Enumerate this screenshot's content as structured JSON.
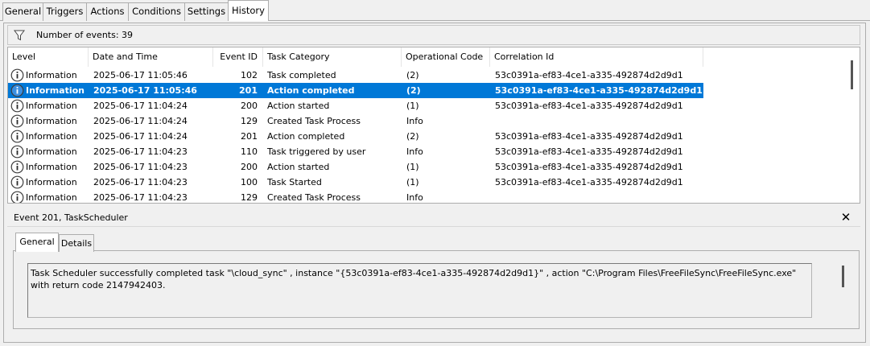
{
  "tabs": [
    "General",
    "Triggers",
    "Actions",
    "Conditions",
    "Settings",
    "History"
  ],
  "active_tab": "History",
  "filter": {
    "label": "Number of events: 39"
  },
  "columns": [
    "Level",
    "Date and Time",
    "Event ID",
    "Task Category",
    "Operational Code",
    "Correlation Id"
  ],
  "events": [
    {
      "level": "Information",
      "datetime": "2025-06-17 11:05:46",
      "event_id": "102",
      "category": "Task completed",
      "opcode": "(2)",
      "correlation": "53c0391a-ef83-4ce1-a335-492874d2d9d1"
    },
    {
      "level": "Information",
      "datetime": "2025-06-17 11:05:46",
      "event_id": "201",
      "category": "Action completed",
      "opcode": "(2)",
      "correlation": "53c0391a-ef83-4ce1-a335-492874d2d9d1"
    },
    {
      "level": "Information",
      "datetime": "2025-06-17 11:04:24",
      "event_id": "200",
      "category": "Action started",
      "opcode": "(1)",
      "correlation": "53c0391a-ef83-4ce1-a335-492874d2d9d1"
    },
    {
      "level": "Information",
      "datetime": "2025-06-17 11:04:24",
      "event_id": "129",
      "category": "Created Task Process",
      "opcode": "Info",
      "correlation": ""
    },
    {
      "level": "Information",
      "datetime": "2025-06-17 11:04:24",
      "event_id": "201",
      "category": "Action completed",
      "opcode": "(2)",
      "correlation": "53c0391a-ef83-4ce1-a335-492874d2d9d1"
    },
    {
      "level": "Information",
      "datetime": "2025-06-17 11:04:23",
      "event_id": "110",
      "category": "Task triggered by user",
      "opcode": "Info",
      "correlation": "53c0391a-ef83-4ce1-a335-492874d2d9d1"
    },
    {
      "level": "Information",
      "datetime": "2025-06-17 11:04:23",
      "event_id": "200",
      "category": "Action started",
      "opcode": "(1)",
      "correlation": "53c0391a-ef83-4ce1-a335-492874d2d9d1"
    },
    {
      "level": "Information",
      "datetime": "2025-06-17 11:04:23",
      "event_id": "100",
      "category": "Task Started",
      "opcode": "(1)",
      "correlation": "53c0391a-ef83-4ce1-a335-492874d2d9d1"
    },
    {
      "level": "Information",
      "datetime": "2025-06-17 11:04:23",
      "event_id": "129",
      "category": "Created Task Process",
      "opcode": "Info",
      "correlation": ""
    }
  ],
  "selected_index": 1,
  "detail": {
    "title": "Event 201, TaskScheduler",
    "close_glyph": "✕",
    "tabs": [
      "General",
      "Details"
    ],
    "active_tab": "General",
    "message": "Task Scheduler successfully completed task \"\\cloud_sync\" , instance \"{53c0391a-ef83-4ce1-a335-492874d2d9d1}\" , action \"C:\\Program Files\\FreeFileSync\\FreeFileSync.exe\" with return code 2147942403."
  },
  "colors": {
    "selection": "#0078d7",
    "border": "#adadad",
    "panel": "#f0f0f0"
  },
  "icons": {
    "filter": "filter-icon",
    "level": "information-icon",
    "close": "close-icon"
  }
}
